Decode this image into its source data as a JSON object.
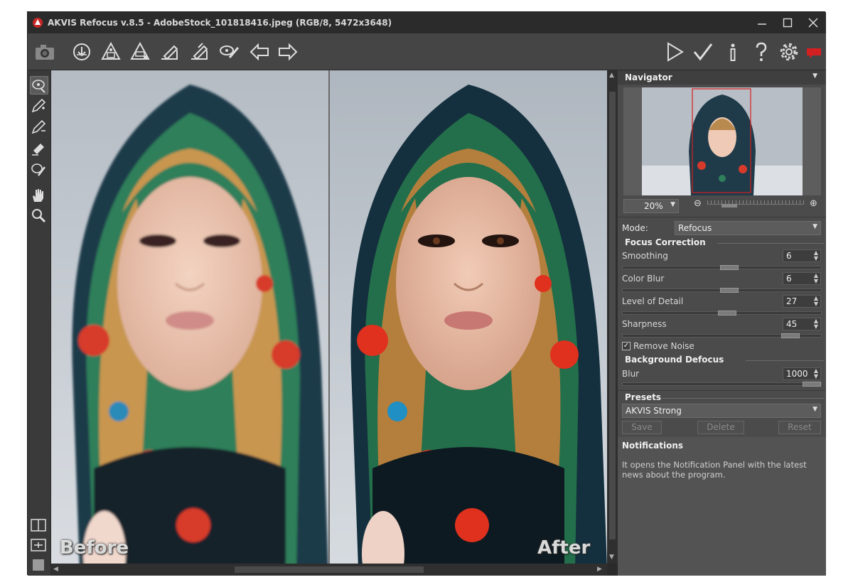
{
  "window": {
    "title": "AKVIS Refocus v.8.5 - AdobeStock_101818416.jpeg (RGB/8, 5472x3648)",
    "controls": [
      "minimize-icon",
      "maximize-icon",
      "close-icon"
    ]
  },
  "toolbar": {
    "left_icons": [
      "camera-icon",
      "open-file-icon",
      "save-file-icon",
      "print-icon",
      "share-icon",
      "batch-icon",
      "brush-preset-icon",
      "back-arrow-icon",
      "forward-arrow-icon"
    ],
    "right_icons": [
      "run-icon",
      "apply-icon",
      "info-icon",
      "help-icon",
      "settings-icon",
      "notification-icon"
    ]
  },
  "tools": [
    "focus-area-tool-icon",
    "pencil-tool-icon",
    "background-pencil-tool-icon",
    "eraser-tool-icon",
    "magic-tube-tool-icon",
    "hand-tool-icon",
    "zoom-tool-icon"
  ],
  "view_buttons": [
    "split-view-icon",
    "compare-view-icon",
    "single-view-icon"
  ],
  "canvas": {
    "before_label": "Before",
    "after_label": "After"
  },
  "navigator": {
    "title": "Navigator",
    "zoom": "20%"
  },
  "mode": {
    "label": "Mode:",
    "value": "Refocus"
  },
  "focus_correction": {
    "title": "Focus Correction",
    "params": [
      {
        "label": "Smoothing",
        "value": "6",
        "level": 0.54
      },
      {
        "label": "Color Blur",
        "value": "6",
        "level": 0.54
      },
      {
        "label": "Level of Detail",
        "value": "27",
        "level": 0.53
      },
      {
        "label": "Sharpness",
        "value": "45",
        "level": 0.88
      }
    ],
    "remove_noise": {
      "label": "Remove Noise",
      "checked": true
    }
  },
  "background_defocus": {
    "title": "Background Defocus",
    "blur": {
      "label": "Blur",
      "value": "1000",
      "level": 1.0
    }
  },
  "presets": {
    "title": "Presets",
    "value": "AKVIS Strong",
    "save": "Save",
    "delete": "Delete",
    "reset": "Reset"
  },
  "notifications": {
    "title": "Notifications",
    "text": "It opens the Notification Panel with the latest news about the program."
  },
  "colors": {
    "window_bg": "#3c3c3c",
    "panel_bg": "#4b4b4b",
    "accent_red": "#d42020"
  }
}
